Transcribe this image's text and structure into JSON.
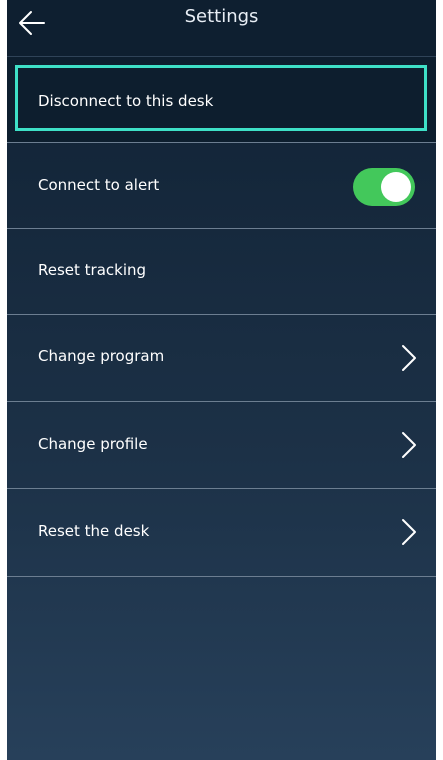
{
  "header": {
    "title": "Settings",
    "back_icon": "arrow-left-icon"
  },
  "items": [
    {
      "label": "Disconnect to this desk",
      "highlighted": true
    },
    {
      "label": "Connect to alert",
      "toggle": {
        "state": "on",
        "color": "#43c85b"
      }
    },
    {
      "label": "Reset tracking"
    },
    {
      "label": "Change program",
      "icon": "chevron-right-icon"
    },
    {
      "label": "Change profile",
      "icon": "chevron-right-icon"
    },
    {
      "label": "Reset the desk",
      "icon": "chevron-right-icon"
    }
  ],
  "colors": {
    "highlight": "#3ee0c7",
    "background": "#16293d"
  }
}
